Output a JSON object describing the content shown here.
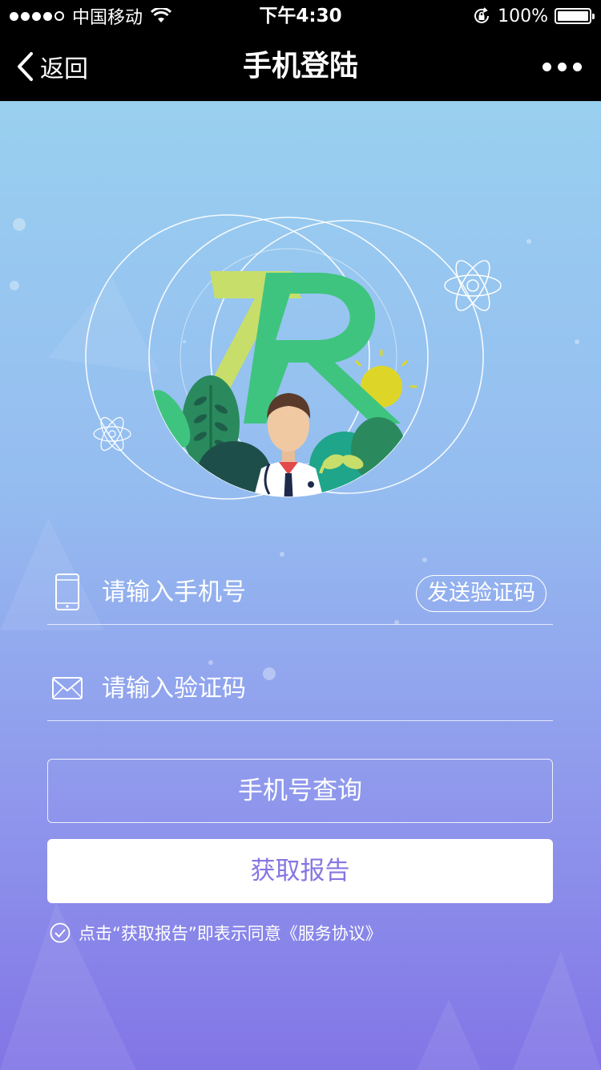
{
  "status_bar": {
    "carrier": "中国移动",
    "time": "下午4:30",
    "battery_text": "100%",
    "battery_level": 1.0
  },
  "nav": {
    "back_label": "返回",
    "title": "手机登陆"
  },
  "form": {
    "phone_placeholder": "请输入手机号",
    "send_code_label": "发送验证码",
    "code_placeholder": "请输入验证码",
    "phone_query_label": "手机号查询",
    "get_report_label": "获取报告",
    "agreement_text": "点击“获取报告”即表示同意《服务协议》"
  },
  "colors": {
    "gradient_top": "#9ad4ef",
    "gradient_bottom": "#8275e6",
    "accent": "#8676e3",
    "logo_green": "#3fc47f",
    "logo_lime": "#c8de6a"
  },
  "icons": [
    "back-chevron-icon",
    "more-dots-icon",
    "phone-icon",
    "envelope-icon",
    "check-circle-icon",
    "wifi-icon",
    "lock-rotation-icon",
    "battery-icon"
  ]
}
